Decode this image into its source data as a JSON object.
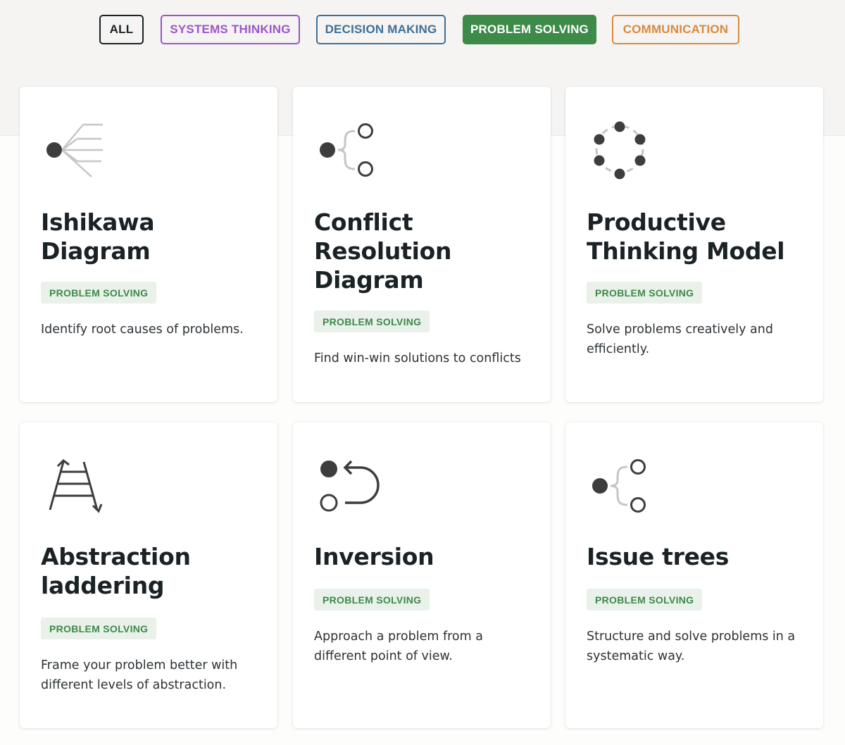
{
  "filters": [
    {
      "label": "ALL",
      "color": "#1b2226",
      "active": false
    },
    {
      "label": "SYSTEMS THINKING",
      "color": "#9b55c8",
      "active": false
    },
    {
      "label": "DECISION MAKING",
      "color": "#3e6f96",
      "active": false
    },
    {
      "label": "PROBLEM SOLVING",
      "color": "#3d8a49",
      "active": true
    },
    {
      "label": "COMMUNICATION",
      "color": "#d88a3f",
      "active": false
    }
  ],
  "cards": [
    {
      "title": "Ishikawa Diagram",
      "tag": "PROBLEM SOLVING",
      "description": "Identify root causes of problems.",
      "icon": "fishbone-icon"
    },
    {
      "title": "Conflict Resolution Diagram",
      "tag": "PROBLEM SOLVING",
      "description": "Find win-win solutions to conflicts",
      "icon": "branch-icon"
    },
    {
      "title": "Productive Thinking Model",
      "tag": "PROBLEM SOLVING",
      "description": "Solve problems creatively and efficiently.",
      "icon": "cycle-icon"
    },
    {
      "title": "Abstraction laddering",
      "tag": "PROBLEM SOLVING",
      "description": "Frame your problem better with different levels of abstraction.",
      "icon": "ladder-icon"
    },
    {
      "title": "Inversion",
      "tag": "PROBLEM SOLVING",
      "description": "Approach a problem from a different point of view.",
      "icon": "inversion-icon"
    },
    {
      "title": "Issue trees",
      "tag": "PROBLEM SOLVING",
      "description": "Structure and solve problems in a systematic way.",
      "icon": "branch-icon"
    }
  ],
  "colors": {
    "accent": "#3d8a49",
    "tag_bg": "#e9f1ea",
    "icon_dark": "#3d3d3d",
    "icon_light": "#c6c6c6"
  }
}
